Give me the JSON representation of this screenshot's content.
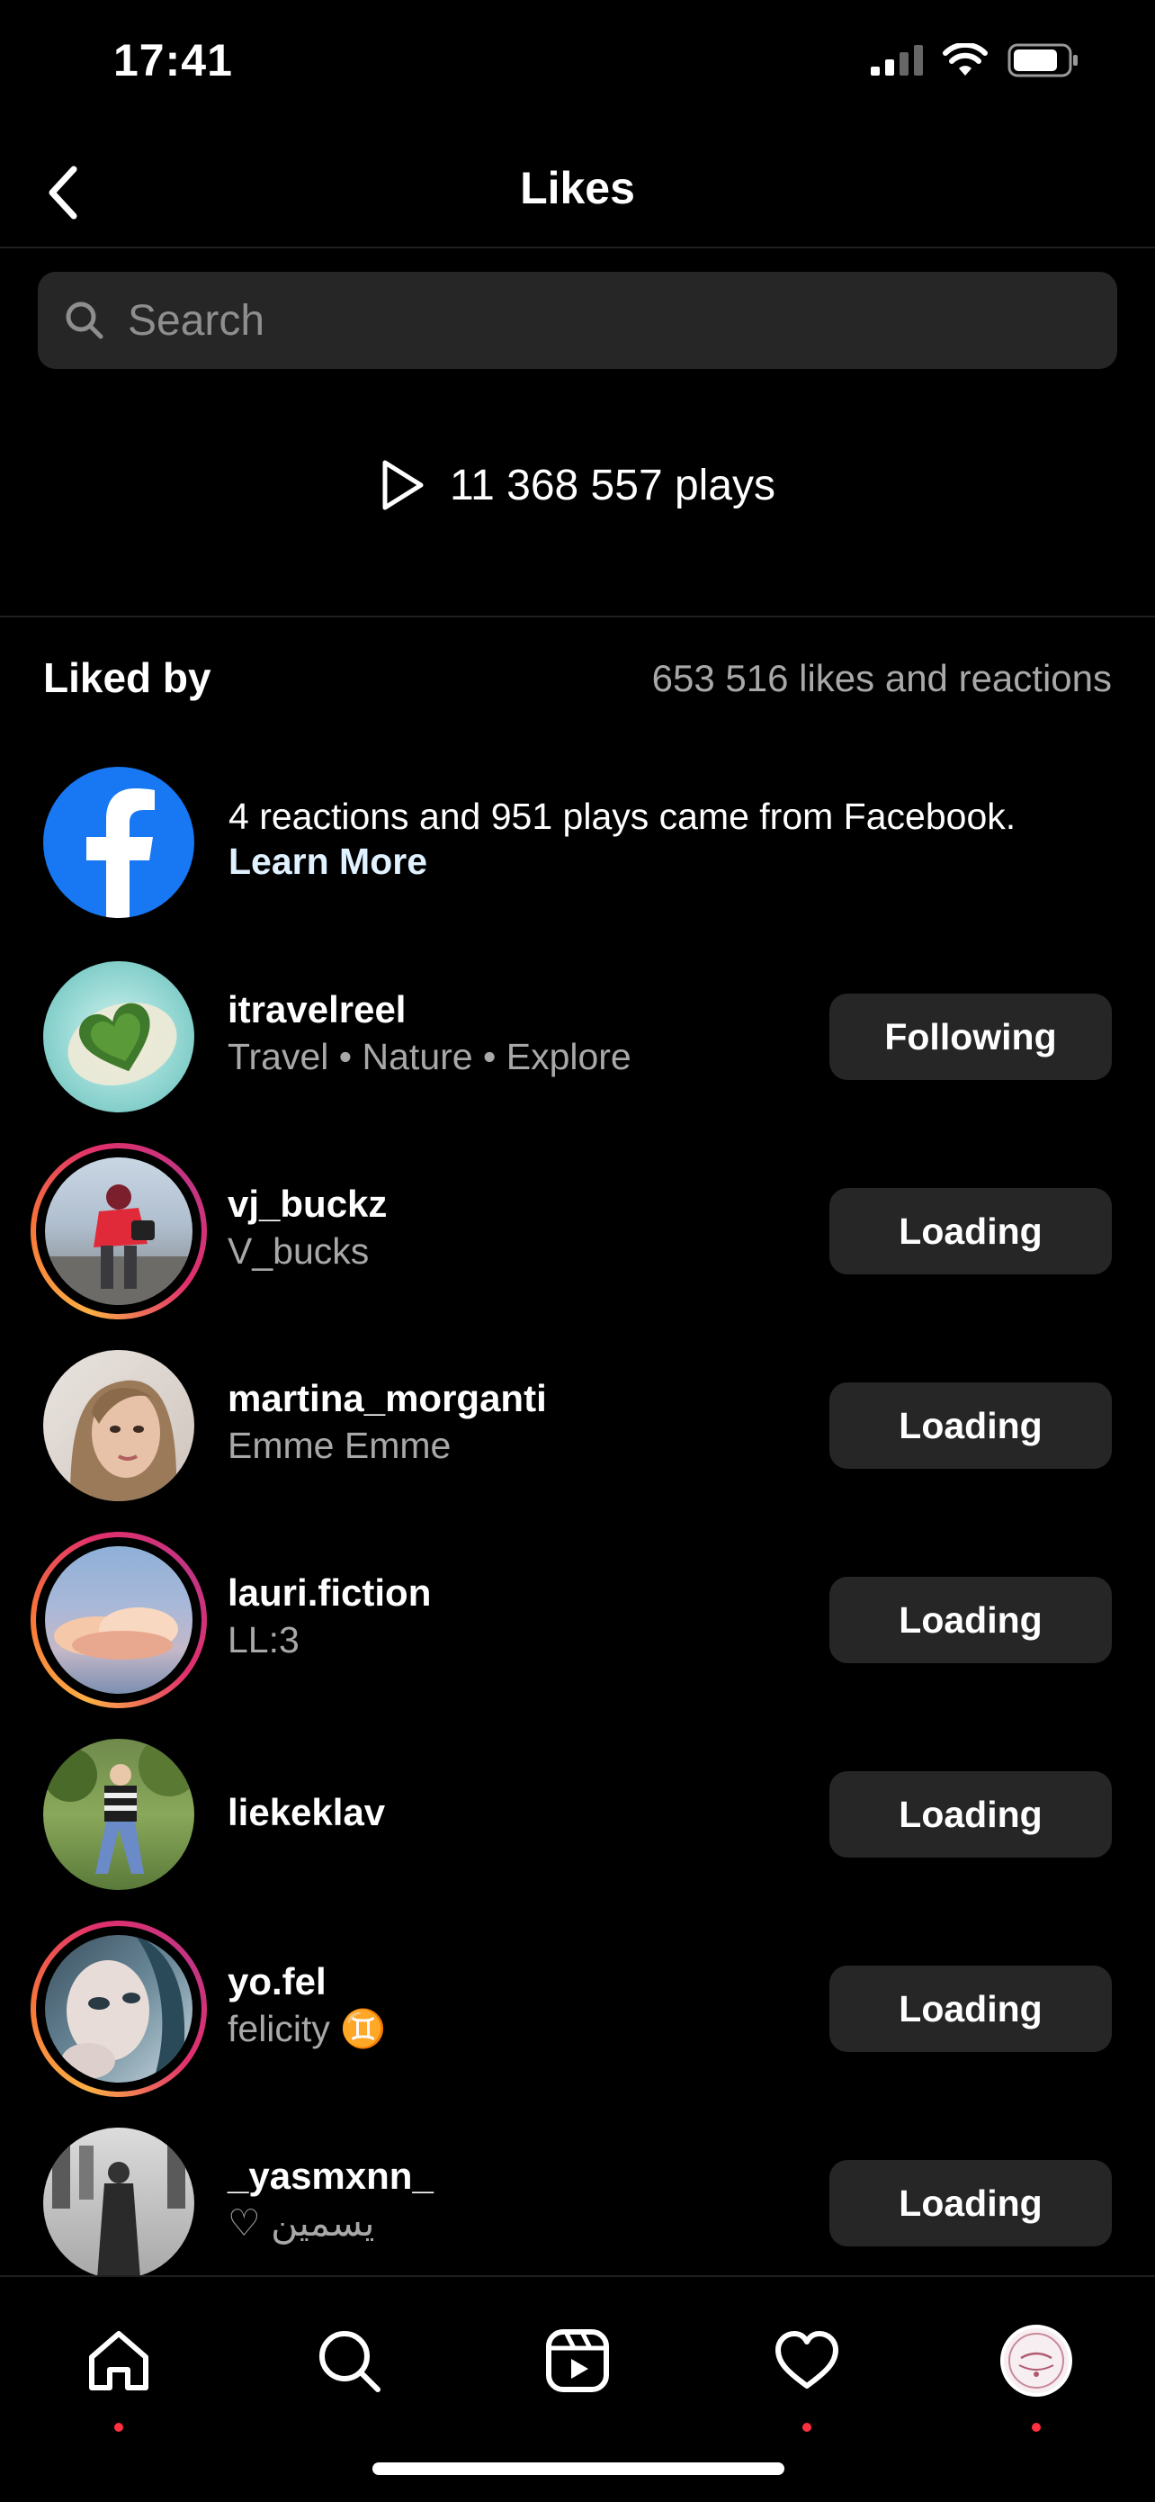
{
  "status_bar": {
    "time": "17:41"
  },
  "header": {
    "title": "Likes"
  },
  "search": {
    "placeholder": "Search"
  },
  "stats": {
    "plays": "11 368 557 plays"
  },
  "liked_by": {
    "title": "Liked by",
    "count": "653 516 likes and reactions",
    "facebook_note": "4 reactions and 951 plays came from Facebook.",
    "learn_more": "Learn More"
  },
  "users": [
    {
      "username": "itravelreel",
      "subtitle": "Travel • Nature • Explore",
      "button": "Following"
    },
    {
      "username": "vj_buckz",
      "subtitle": "V_bucks",
      "button": "Loading"
    },
    {
      "username": "martina_morganti",
      "subtitle": "Emme Emme",
      "button": "Loading"
    },
    {
      "username": "lauri.fiction",
      "subtitle": "LL:3",
      "button": "Loading"
    },
    {
      "username": "liekeklav",
      "subtitle": "",
      "button": "Loading"
    },
    {
      "username": "yo.fel",
      "subtitle": "felicity ♊️",
      "button": "Loading"
    },
    {
      "username": "_yasmxnn_",
      "subtitle": "♡ يسمين",
      "button": "Loading"
    }
  ],
  "icons": {
    "back": "chevron-left-icon",
    "search": "magnifier-icon",
    "plays": "play-outline-icon",
    "tabs": [
      "home-icon",
      "search-icon",
      "reels-icon",
      "heart-icon",
      "profile-avatar"
    ]
  },
  "colors": {
    "background": "#000000",
    "button": "#262626",
    "facebook": "#1877f2",
    "notification": "#ff3040"
  }
}
